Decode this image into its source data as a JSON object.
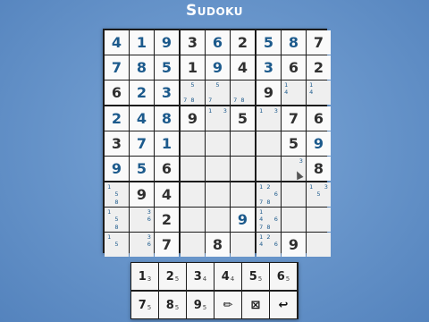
{
  "title": "Sudoku",
  "board": [
    [
      {
        "v": "4",
        "t": "user"
      },
      {
        "v": "1",
        "t": "user"
      },
      {
        "v": "9",
        "t": "user"
      },
      {
        "v": "3",
        "t": "given"
      },
      {
        "v": "6",
        "t": "user"
      },
      {
        "v": "2",
        "t": "given"
      },
      {
        "v": "5",
        "t": "user"
      },
      {
        "v": "8",
        "t": "user"
      },
      {
        "v": "7",
        "t": "given"
      }
    ],
    [
      {
        "v": "7",
        "t": "user"
      },
      {
        "v": "8",
        "t": "user"
      },
      {
        "v": "5",
        "t": "user"
      },
      {
        "v": "1",
        "t": "given"
      },
      {
        "v": "9",
        "t": "user"
      },
      {
        "v": "4",
        "t": "given"
      },
      {
        "v": "3",
        "t": "user"
      },
      {
        "v": "6",
        "t": "given"
      },
      {
        "v": "2",
        "t": "given"
      }
    ],
    [
      {
        "v": "6",
        "t": "given"
      },
      {
        "v": "2",
        "t": "user"
      },
      {
        "v": "3",
        "t": "user"
      },
      {
        "n": [
          "",
          "5",
          "",
          "",
          "",
          "",
          "7",
          "8",
          ""
        ]
      },
      {
        "n": [
          "",
          "5",
          "",
          "",
          "",
          "",
          "7",
          "",
          ""
        ]
      },
      {
        "n": [
          "",
          "",
          "",
          "",
          "",
          "",
          "7",
          "8",
          ""
        ]
      },
      {
        "v": "9",
        "t": "given"
      },
      {
        "n": [
          "1",
          "",
          "",
          "4",
          "",
          "",
          "",
          "",
          ""
        ]
      },
      {
        "n": [
          "1",
          "",
          "",
          "4",
          "",
          "",
          "",
          "",
          ""
        ]
      }
    ],
    [
      {
        "v": "2",
        "t": "user"
      },
      {
        "v": "4",
        "t": "user"
      },
      {
        "v": "8",
        "t": "user"
      },
      {
        "v": "9",
        "t": "given"
      },
      {
        "n": [
          "1",
          "",
          "3",
          "",
          "",
          "",
          "",
          "",
          ""
        ]
      },
      {
        "v": "5",
        "t": "given"
      },
      {
        "n": [
          "1",
          "",
          "3",
          "",
          "",
          "",
          "",
          "",
          ""
        ]
      },
      {
        "v": "7",
        "t": "given"
      },
      {
        "v": "6",
        "t": "given"
      }
    ],
    [
      {
        "v": "3",
        "t": "given"
      },
      {
        "v": "7",
        "t": "user"
      },
      {
        "v": "1",
        "t": "user"
      },
      {
        "e": true
      },
      {
        "e": true
      },
      {
        "e": true
      },
      {
        "e": true
      },
      {
        "v": "5",
        "t": "given"
      },
      {
        "v": "9",
        "t": "user"
      }
    ],
    [
      {
        "v": "9",
        "t": "user"
      },
      {
        "v": "5",
        "t": "user"
      },
      {
        "v": "6",
        "t": "given"
      },
      {
        "e": true
      },
      {
        "e": true
      },
      {
        "e": true
      },
      {
        "e": true
      },
      {
        "n": [
          "",
          "",
          "3",
          "",
          "",
          "",
          "",
          "",
          ""
        ]
      },
      {
        "v": "8",
        "t": "given"
      }
    ],
    [
      {
        "n": [
          "1",
          "",
          "",
          "",
          "5",
          "",
          "",
          "8",
          ""
        ]
      },
      {
        "v": "9",
        "t": "given"
      },
      {
        "v": "4",
        "t": "given"
      },
      {
        "e": true
      },
      {
        "e": true
      },
      {
        "e": true
      },
      {
        "n": [
          "1",
          "2",
          "",
          "",
          "",
          "6",
          "7",
          "8",
          ""
        ]
      },
      {
        "e": true
      },
      {
        "n": [
          "1",
          "",
          "3",
          "",
          "5",
          "",
          "",
          "",
          ""
        ]
      }
    ],
    [
      {
        "n": [
          "1",
          "",
          "",
          "",
          "5",
          "",
          "",
          "8",
          ""
        ]
      },
      {
        "n": [
          "",
          "",
          "3",
          "",
          "",
          "6",
          "",
          "",
          ""
        ]
      },
      {
        "v": "2",
        "t": "given"
      },
      {
        "e": true
      },
      {
        "e": true
      },
      {
        "v": "9",
        "t": "user"
      },
      {
        "n": [
          "1",
          "",
          "",
          "4",
          "",
          "6",
          "7",
          "8",
          ""
        ]
      },
      {
        "e": true
      },
      {
        "e": true
      }
    ],
    [
      {
        "n": [
          "1",
          "",
          "",
          "",
          "5",
          "",
          "",
          "",
          ""
        ]
      },
      {
        "n": [
          "",
          "",
          "3",
          "",
          "",
          "6",
          "",
          "",
          ""
        ]
      },
      {
        "v": "7",
        "t": "given"
      },
      {
        "e": true
      },
      {
        "v": "8",
        "t": "given"
      },
      {
        "e": true
      },
      {
        "n": [
          "1",
          "2",
          "",
          "4",
          "",
          "6",
          "",
          "",
          ""
        ]
      },
      {
        "v": "9",
        "t": "given"
      },
      {
        "e": true
      }
    ]
  ],
  "keypad": [
    {
      "digit": "1",
      "count": "3",
      "name": "digit-1-key"
    },
    {
      "digit": "2",
      "count": "5",
      "name": "digit-2-key"
    },
    {
      "digit": "3",
      "count": "4",
      "name": "digit-3-key"
    },
    {
      "digit": "4",
      "count": "4",
      "name": "digit-4-key"
    },
    {
      "digit": "5",
      "count": "5",
      "name": "digit-5-key"
    },
    {
      "digit": "6",
      "count": "5",
      "name": "digit-6-key"
    },
    {
      "digit": "7",
      "count": "5",
      "name": "digit-7-key"
    },
    {
      "digit": "8",
      "count": "5",
      "name": "digit-8-key"
    },
    {
      "digit": "9",
      "count": "5",
      "name": "digit-9-key"
    },
    {
      "icon": "pencil-icon",
      "glyph": "✏",
      "name": "notes-mode-key"
    },
    {
      "icon": "erase-icon",
      "glyph": "⊠",
      "name": "erase-key"
    },
    {
      "icon": "undo-arrow-icon",
      "glyph": "↩",
      "name": "undo-key"
    }
  ],
  "colors": {
    "user_digit": "#1c5a8c",
    "given_digit": "#303030",
    "background": "#6a97cc"
  }
}
